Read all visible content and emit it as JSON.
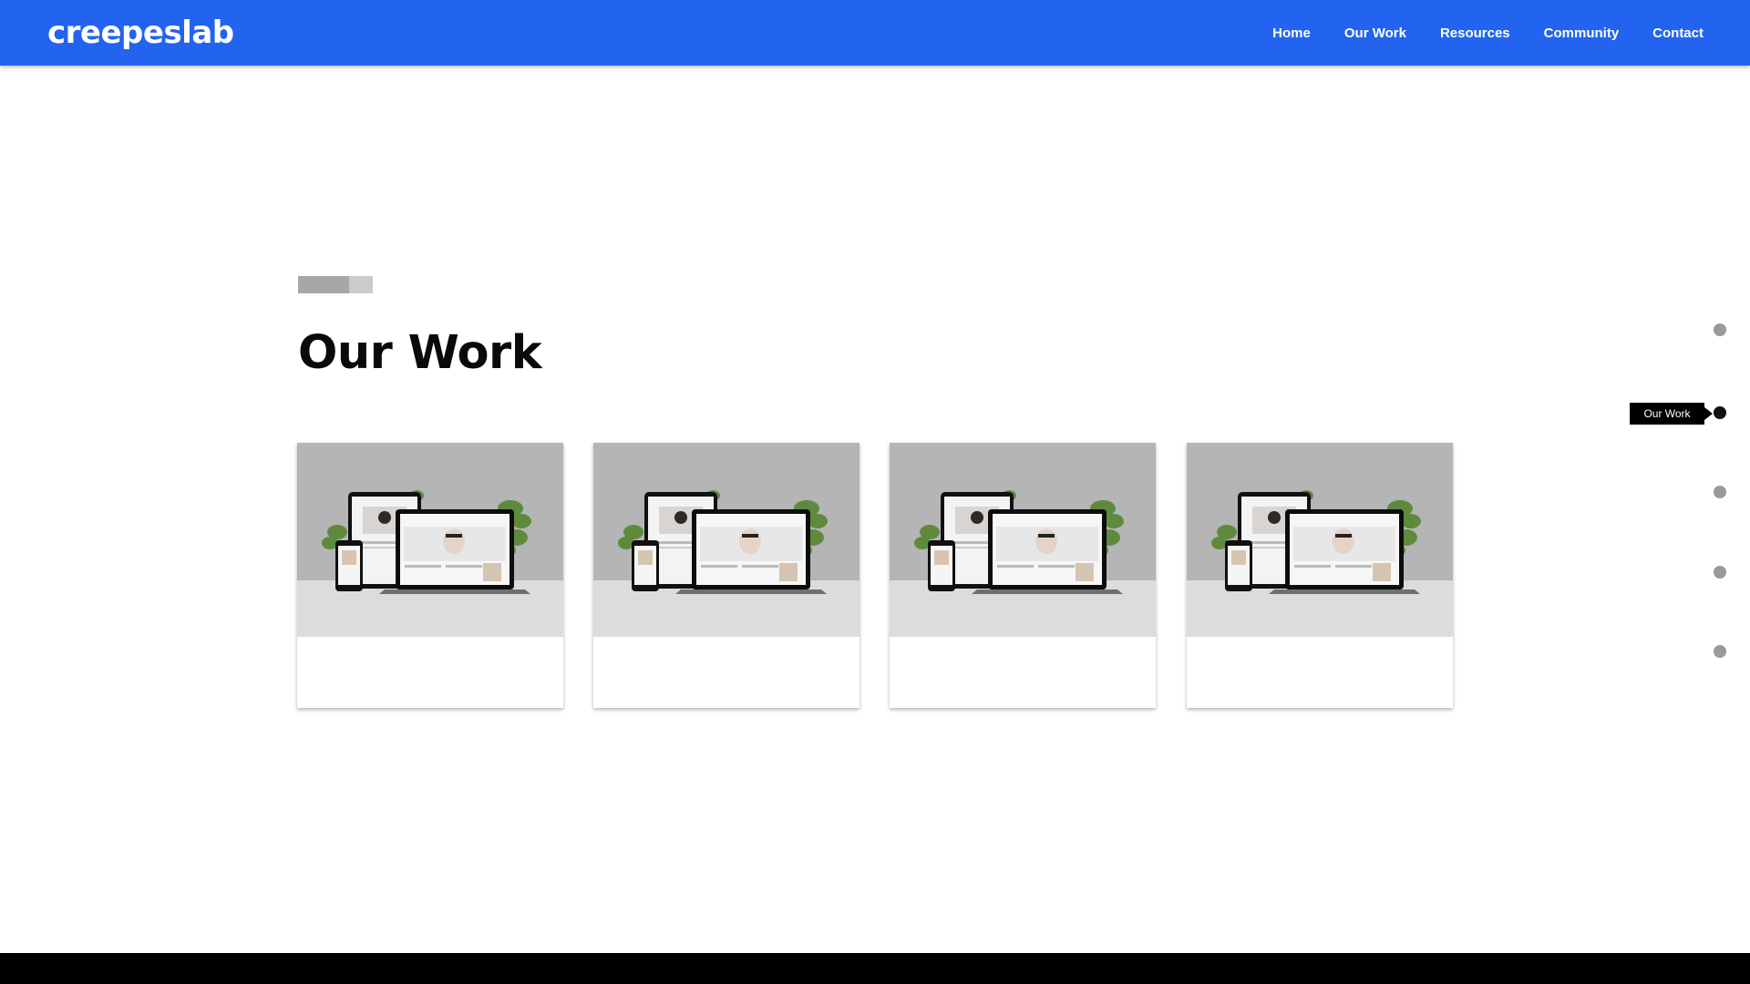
{
  "nav": {
    "brand": "creepeslab",
    "links": [
      "Home",
      "Our Work",
      "Resources",
      "Community",
      "Contact"
    ]
  },
  "section": {
    "title": "Our Work"
  },
  "cards": [
    {
      "image": "responsive-devices-mockup"
    },
    {
      "image": "responsive-devices-mockup"
    },
    {
      "image": "responsive-devices-mockup"
    },
    {
      "image": "responsive-devices-mockup"
    }
  ],
  "dot_nav": {
    "active_index": 1,
    "tooltip": "Our Work",
    "count": 5
  },
  "colors": {
    "navbar": "#2264f0",
    "dot_inactive": "#9a9a9a",
    "dot_active": "#111111",
    "footer": "#000000"
  }
}
